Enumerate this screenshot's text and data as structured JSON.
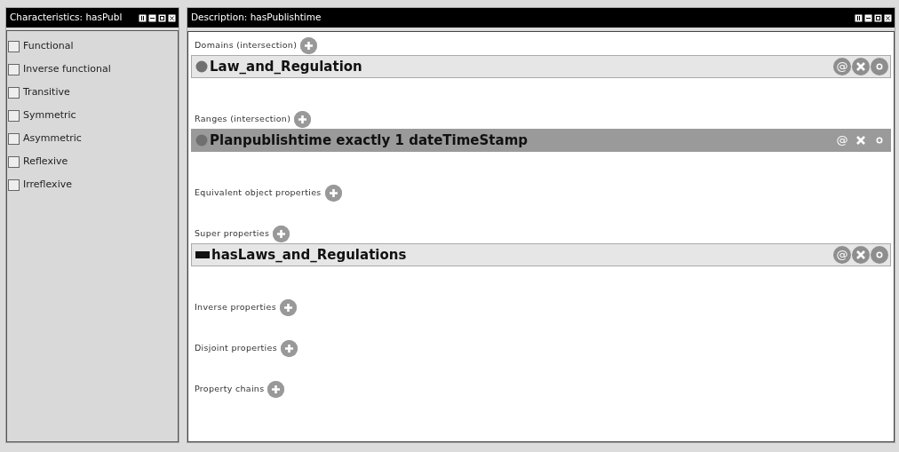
{
  "left_panel": {
    "title": "Characteristics: hasPubl",
    "characteristics": [
      {
        "label": "Functional",
        "checked": false
      },
      {
        "label": "Inverse functional",
        "checked": false
      },
      {
        "label": "Transitive",
        "checked": false
      },
      {
        "label": "Symmetric",
        "checked": false
      },
      {
        "label": "Asymmetric",
        "checked": false
      },
      {
        "label": "Reflexive",
        "checked": false
      },
      {
        "label": "Irreflexive",
        "checked": false
      }
    ]
  },
  "right_panel": {
    "title": "Description: hasPublishtime",
    "sections": [
      {
        "label": "Domains (intersection)",
        "entries": [
          {
            "kind": "class",
            "text": "Law_and_Regulation",
            "selected": false,
            "annotation_symbol": "@"
          }
        ]
      },
      {
        "label": "Ranges (intersection)",
        "entries": [
          {
            "kind": "class",
            "text": "Planpublishtime exactly 1 dateTimeStamp",
            "selected": true,
            "annotation_symbol": "@"
          }
        ]
      },
      {
        "label": "Equivalent object properties"
      },
      {
        "label": "Super properties",
        "entries": [
          {
            "kind": "property",
            "text": "hasLaws_and_Regulations",
            "selected": false,
            "annotation_symbol": "@"
          }
        ]
      },
      {
        "label": "Inverse properties"
      },
      {
        "label": "Disjoint properties"
      },
      {
        "label": "Property chains"
      }
    ]
  }
}
